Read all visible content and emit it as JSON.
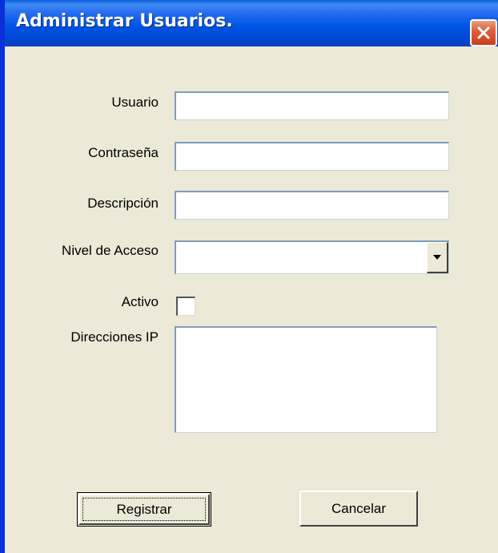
{
  "window": {
    "title": "Administrar Usuarios."
  },
  "form": {
    "usuario": {
      "label": "Usuario",
      "value": ""
    },
    "contrasena": {
      "label": "Contraseña",
      "value": ""
    },
    "descripcion": {
      "label": "Descripción",
      "value": ""
    },
    "nivel_acceso": {
      "label": "Nivel de Acceso",
      "selected": ""
    },
    "activo": {
      "label": "Activo",
      "checked": false
    },
    "direcciones_ip": {
      "label": "Direcciones IP",
      "value": ""
    }
  },
  "buttons": {
    "registrar_label": "Registrar",
    "cancelar_label": "Cancelar"
  },
  "icons": {
    "close": "close-icon",
    "dropdown": "chevron-down-icon"
  },
  "colors": {
    "title_bar": "#0055e5",
    "close_button": "#e0603b",
    "dialog_background": "#ece9d8",
    "window_border": "#0831d9"
  }
}
